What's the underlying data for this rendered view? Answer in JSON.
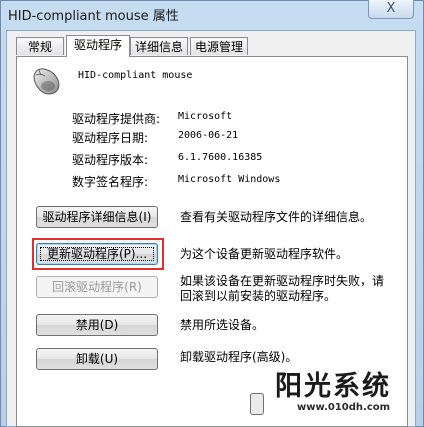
{
  "window": {
    "title": "HID-compliant mouse 属性",
    "close_label": "X"
  },
  "tabs": [
    {
      "label": "常规",
      "active": false
    },
    {
      "label": "驱动程序",
      "active": true
    },
    {
      "label": "详细信息",
      "active": false
    },
    {
      "label": "电源管理",
      "active": false
    }
  ],
  "device": {
    "name": "HID-compliant mouse",
    "icon": "mouse-icon"
  },
  "info": [
    {
      "label": "驱动程序提供商:",
      "value": "Microsoft"
    },
    {
      "label": "驱动程序日期:",
      "value": "2006-06-21"
    },
    {
      "label": "驱动程序版本:",
      "value": "6.1.7600.16385"
    },
    {
      "label": "数字签名程序:",
      "value": "Microsoft Windows"
    }
  ],
  "actions": {
    "details": {
      "label": "驱动程序详细信息(I)",
      "desc": "查看有关驱动程序文件的详细信息。"
    },
    "update": {
      "label": "更新驱动程序(P)...",
      "desc": "为这个设备更新驱动程序软件。"
    },
    "rollback": {
      "label": "回滚驱动程序(R)",
      "desc_line1": "如果该设备在更新驱动程序时失败，请",
      "desc_line2": "回滚到以前安装的驱动程序。",
      "enabled": false
    },
    "disable": {
      "label": "禁用(D)",
      "desc": "禁用所选设备。"
    },
    "uninstall": {
      "label": "卸载(U)",
      "desc": "卸载驱动程序(高级)。"
    }
  },
  "watermark": {
    "title": "阳光系统",
    "url": "www.010dh.com"
  },
  "colors": {
    "highlight": "#e0302d",
    "frame": "#b9d1ea"
  }
}
